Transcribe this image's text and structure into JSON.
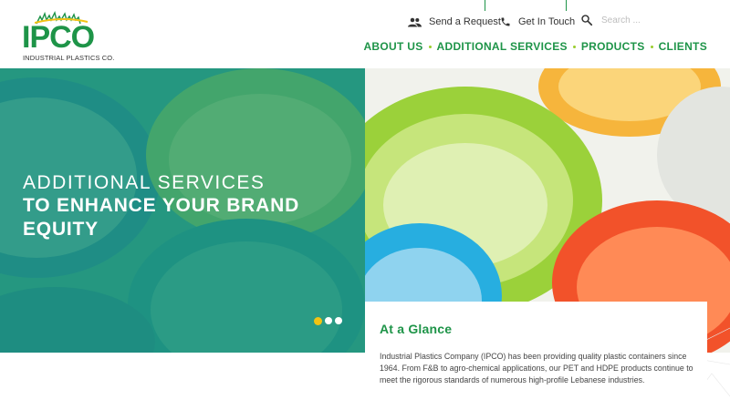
{
  "brand": {
    "name": "IPCO",
    "tagline": "INDUSTRIAL PLASTICS CO.",
    "color": "#1e9448",
    "accent": "#9acd2c"
  },
  "utility_links": [
    {
      "label": "Send a Request",
      "icon": "people-icon"
    },
    {
      "label": "Get In Touch",
      "icon": "phone-icon"
    }
  ],
  "search": {
    "placeholder": "Search ...",
    "icon": "search-icon"
  },
  "nav": {
    "items": [
      "ABOUT US",
      "ADDITIONAL SERVICES",
      "PRODUCTS",
      "CLIENTS"
    ]
  },
  "hero": {
    "kicker": "ADDITIONAL SERVICES",
    "title": "TO ENHANCE YOUR BRAND EQUITY",
    "slides": 3,
    "active_slide": 1,
    "dot_active_color": "#f3c313"
  },
  "glance": {
    "title": "At a Glance",
    "body": "Industrial Plastics Company (IPCO) has been providing quality plastic containers since 1964. From F&B to agro-chemical applications, our PET and HDPE products continue to meet the rigorous standards of numerous high-profile Lebanese industries."
  }
}
